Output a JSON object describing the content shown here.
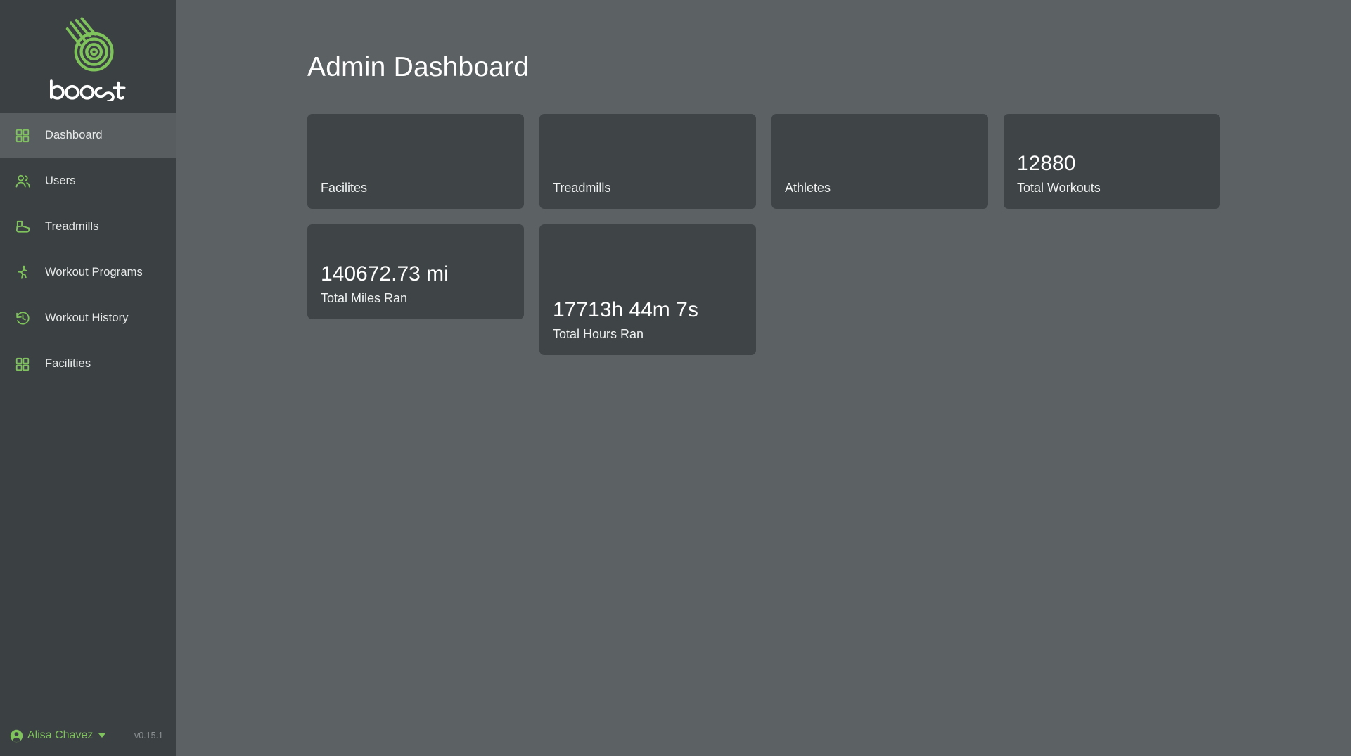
{
  "brand": {
    "name": "boost",
    "logo_icon": "boost-spiral-logo",
    "accent_color": "#7fc35c"
  },
  "sidebar": {
    "items": [
      {
        "label": "Dashboard",
        "icon": "grid-icon",
        "active": true
      },
      {
        "label": "Users",
        "icon": "users-icon",
        "active": false
      },
      {
        "label": "Treadmills",
        "icon": "treadmill-icon",
        "active": false
      },
      {
        "label": "Workout Programs",
        "icon": "running-person-icon",
        "active": false
      },
      {
        "label": "Workout History",
        "icon": "clock-rewind-icon",
        "active": false
      },
      {
        "label": "Facilities",
        "icon": "grid-icon",
        "active": false
      }
    ],
    "footer": {
      "user_name": "Alisa Chavez",
      "user_icon": "user-circle-icon",
      "caret_icon": "caret-down-icon",
      "version": "v0.15.1"
    }
  },
  "main": {
    "title": "Admin Dashboard",
    "cards": [
      {
        "value": "",
        "label": "Facilites"
      },
      {
        "value": "",
        "label": "Treadmills"
      },
      {
        "value": "",
        "label": "Athletes"
      },
      {
        "value": "12880",
        "label": "Total Workouts"
      },
      {
        "value": "140672.73 mi",
        "label": "Total Miles Ran"
      },
      {
        "value": "17713h 44m 7s",
        "label": "Total Hours Ran"
      }
    ]
  }
}
